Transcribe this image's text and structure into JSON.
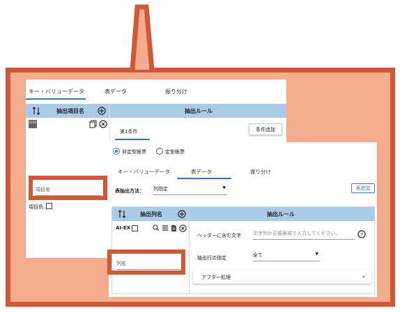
{
  "back_panel": {
    "tabs": [
      "キー・バリューデータ",
      "表データ",
      "振り分け"
    ],
    "left_header": "抽出項目名",
    "right_header": "抽出ルール",
    "item_badge": "AI EX",
    "item_name_placeholder": "項目名",
    "item_color_label": "項目色:",
    "condition_tab": "第1条件",
    "add_condition_button": "条件追加"
  },
  "front_panel": {
    "radio_options": [
      {
        "label": "非定型帳票",
        "selected": true
      },
      {
        "label": "定型帳票",
        "selected": false
      }
    ],
    "tabs": [
      "キー・バリューデータ",
      "表データ",
      "振り分け"
    ],
    "extract_method_label": "表抽出方法：",
    "extract_method_value": "列指定",
    "add_table_button": "表追加",
    "left_header": "抽出列名",
    "right_header": "抽出ルール",
    "column_badge": "AI-EX",
    "column_name_placeholder": "列名",
    "header_text_label": "ヘッダーに含む文字",
    "header_text_placeholder": "文字列か正規表現で入力してください。",
    "row_spec_label": "抽出行の指定",
    "row_spec_value": "全て",
    "after_process_label": "アフター処理"
  },
  "colors": {
    "callout_fill": "#f3aa8d",
    "callout_border": "#cf5837",
    "header_blue": "#a9cbe8",
    "accent_blue": "#3a78c7"
  }
}
